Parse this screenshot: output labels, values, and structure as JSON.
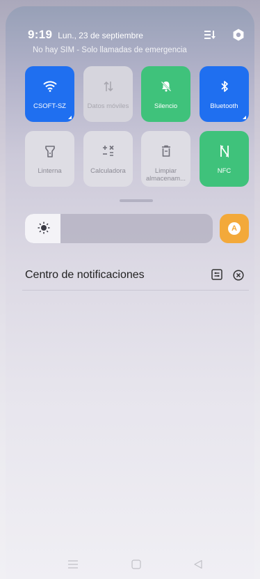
{
  "status": {
    "time": "9:19",
    "date": "Lun., 23 de septiembre",
    "sim_status": "No hay SIM - Solo llamadas de emergencia"
  },
  "tiles": [
    {
      "label": "CSOFT-SZ",
      "icon": "wifi-icon",
      "state": "on"
    },
    {
      "label": "Datos móviles",
      "icon": "mobile-data-icon",
      "state": "disabled"
    },
    {
      "label": "Silencio",
      "icon": "silent-icon",
      "state": "on"
    },
    {
      "label": "Bluetooth",
      "icon": "bluetooth-icon",
      "state": "on"
    },
    {
      "label": "Linterna",
      "icon": "flashlight-icon",
      "state": "off"
    },
    {
      "label": "Calculadora",
      "icon": "calculator-icon",
      "state": "off"
    },
    {
      "label": "Limpiar almacenam...",
      "icon": "trash-icon",
      "state": "off"
    },
    {
      "label": "NFC",
      "icon": "nfc-icon",
      "state": "on"
    }
  ],
  "brightness": {
    "level": 0.19,
    "auto_label": "A"
  },
  "notifications": {
    "title": "Centro de notificaciones"
  },
  "colors": {
    "blue": "#1f6ff0",
    "green": "#3fc27b",
    "orange": "#f3a93a"
  }
}
